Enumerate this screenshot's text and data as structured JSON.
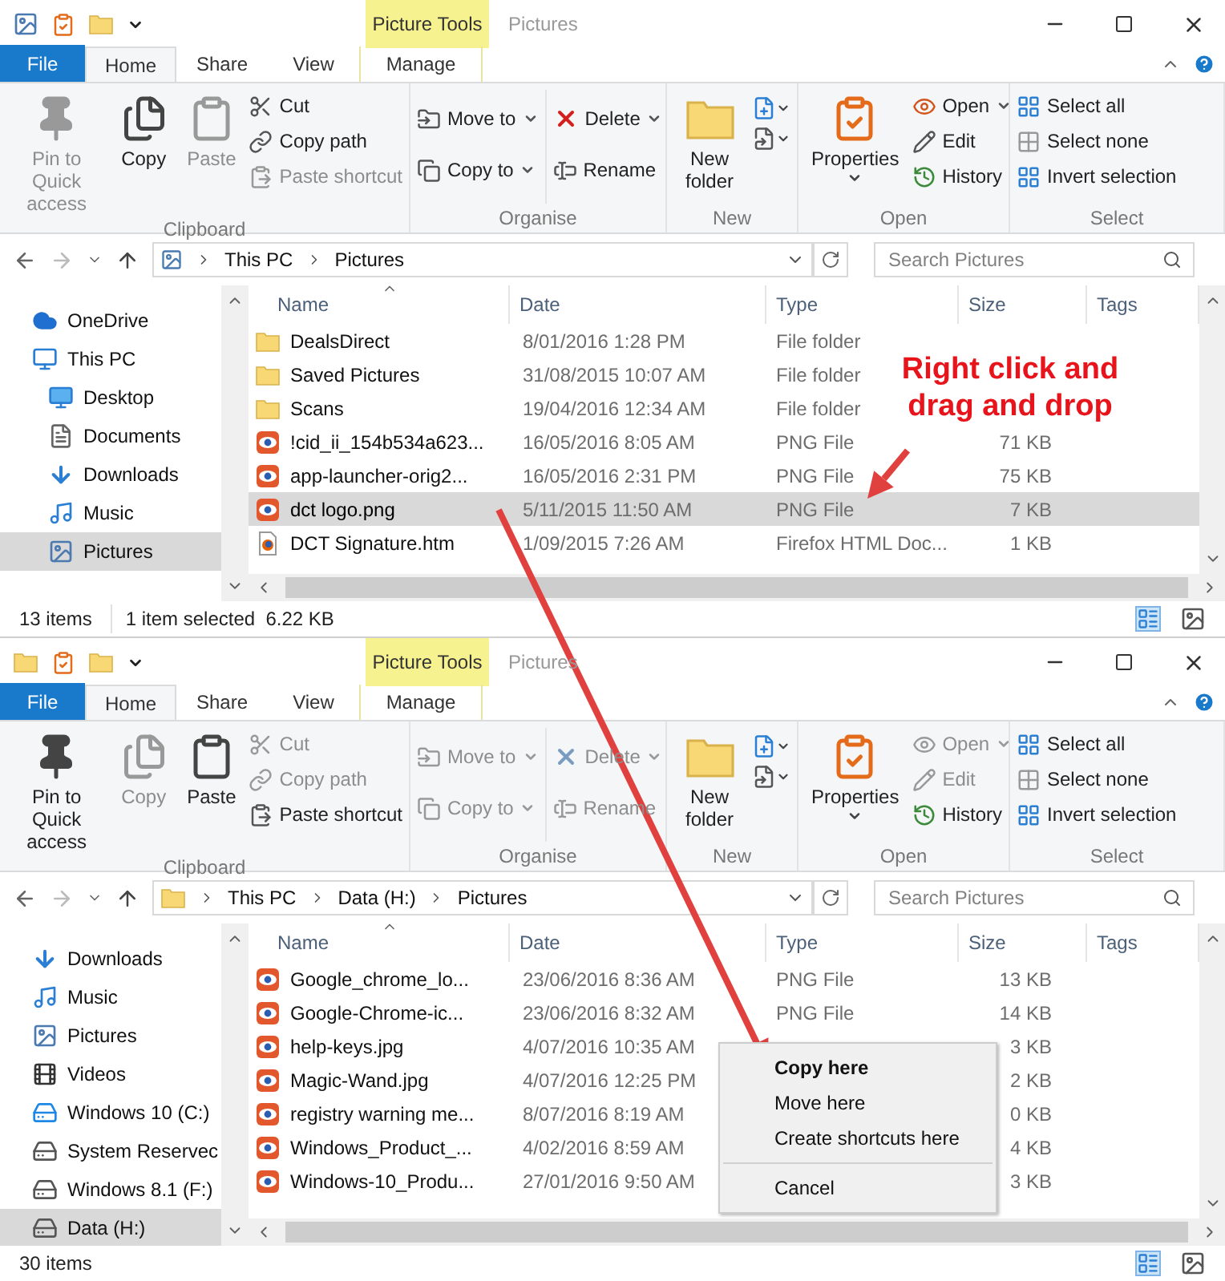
{
  "windows": [
    {
      "contextual_tab": "Picture Tools",
      "title": "Pictures",
      "file_tab": "File",
      "tabs": [
        {
          "label": "Home",
          "selected": true
        },
        {
          "label": "Share",
          "selected": false
        },
        {
          "label": "View",
          "selected": false
        },
        {
          "label": "Manage",
          "selected": false
        }
      ],
      "groups": [
        {
          "kind": "clipboard",
          "label": "Clipboard",
          "large": [
            {
              "label": "Pin to Quick access",
              "disabled": true,
              "dropdown": false
            },
            {
              "label": "Copy",
              "disabled": false,
              "dropdown": false
            },
            {
              "label": "Paste",
              "disabled": true,
              "dropdown": false
            }
          ],
          "small_columns": [
            [
              {
                "label": "Cut",
                "disabled": false,
                "dropdown": false
              },
              {
                "label": "Copy path",
                "disabled": false,
                "dropdown": false
              },
              {
                "label": "Paste shortcut",
                "disabled": true,
                "dropdown": false
              }
            ]
          ]
        },
        {
          "kind": "organise",
          "label": "Organise",
          "small_columns": [
            [
              {
                "label": "Move to",
                "disabled": false,
                "dropdown": true
              },
              {
                "label": "Copy to",
                "disabled": false,
                "dropdown": true
              }
            ],
            [
              {
                "label": "Delete",
                "disabled": false,
                "dropdown": true
              },
              {
                "label": "Rename",
                "disabled": false,
                "dropdown": false
              }
            ]
          ]
        },
        {
          "kind": "new",
          "label": "New",
          "large": [
            {
              "label": "New folder",
              "disabled": false,
              "dropdown": false
            }
          ]
        },
        {
          "kind": "open",
          "label": "Open",
          "large": [
            {
              "label": "Properties",
              "disabled": false,
              "dropdown": true
            }
          ],
          "small_columns": [
            [
              {
                "label": "Open",
                "disabled": false,
                "dropdown": true
              },
              {
                "label": "Edit",
                "disabled": false,
                "dropdown": false
              },
              {
                "label": "History",
                "disabled": false,
                "dropdown": false
              }
            ]
          ]
        },
        {
          "kind": "select",
          "label": "Select",
          "small_columns": [
            [
              {
                "label": "Select all",
                "disabled": false,
                "dropdown": false
              },
              {
                "label": "Select none",
                "disabled": false,
                "dropdown": false
              },
              {
                "label": "Invert selection",
                "disabled": false,
                "dropdown": false
              }
            ]
          ]
        }
      ],
      "path": [
        "This PC",
        "Pictures"
      ],
      "search": {
        "placeholder": "Search Pictures"
      },
      "nav": [
        {
          "label": "OneDrive",
          "kind": "cloud",
          "selected": false
        },
        {
          "label": "This PC",
          "kind": "pc",
          "selected": false,
          "children": [
            {
              "label": "Desktop",
              "kind": "desktop",
              "selected": false
            },
            {
              "label": "Documents",
              "kind": "documents",
              "selected": false
            },
            {
              "label": "Downloads",
              "kind": "downloads",
              "selected": false
            },
            {
              "label": "Music",
              "kind": "music",
              "selected": false
            },
            {
              "label": "Pictures",
              "kind": "pictures",
              "selected": true
            }
          ]
        }
      ],
      "columns": [
        "Name",
        "Date",
        "Type",
        "Size",
        "Tags"
      ],
      "rows": [
        {
          "name": "DealsDirect",
          "date": "8/01/2016 1:28 PM",
          "type": "File folder",
          "kind": "folder",
          "selected": false
        },
        {
          "name": "Saved Pictures",
          "date": "31/08/2015 10:07 AM",
          "type": "File folder",
          "kind": "folder",
          "selected": false
        },
        {
          "name": "Scans",
          "date": "19/04/2016 12:34 AM",
          "type": "File folder",
          "kind": "folder",
          "selected": false
        },
        {
          "name": "!cid_ii_154b534a623...",
          "date": "16/05/2016 8:05 AM",
          "type": "PNG File",
          "size": "71 KB",
          "kind": "image",
          "selected": false
        },
        {
          "name": "app-launcher-orig2...",
          "date": "16/05/2016 2:31 PM",
          "type": "PNG File",
          "size": "75 KB",
          "kind": "image",
          "selected": false
        },
        {
          "name": "dct logo.png",
          "date": "5/11/2015 11:50 AM",
          "type": "PNG File",
          "size": "7 KB",
          "kind": "image",
          "selected": true
        },
        {
          "name": "DCT Signature.htm",
          "date": "1/09/2015 7:26 AM",
          "type": "Firefox HTML Doc...",
          "size": "1 KB",
          "kind": "web",
          "selected": false
        }
      ],
      "status": [
        "13 items",
        "1 item selected  6.22 KB"
      ]
    },
    {
      "contextual_tab": "Picture Tools",
      "title": "Pictures",
      "file_tab": "File",
      "tabs": [
        {
          "label": "Home",
          "selected": true
        },
        {
          "label": "Share",
          "selected": false
        },
        {
          "label": "View",
          "selected": false
        },
        {
          "label": "Manage",
          "selected": false
        }
      ],
      "groups": [
        {
          "kind": "clipboard",
          "label": "Clipboard",
          "large": [
            {
              "label": "Pin to Quick access",
              "disabled": false,
              "dropdown": false
            },
            {
              "label": "Copy",
              "disabled": true,
              "dropdown": false
            },
            {
              "label": "Paste",
              "disabled": false,
              "dropdown": false
            }
          ],
          "small_columns": [
            [
              {
                "label": "Cut",
                "disabled": true,
                "dropdown": false
              },
              {
                "label": "Copy path",
                "disabled": true,
                "dropdown": false
              },
              {
                "label": "Paste shortcut",
                "disabled": false,
                "dropdown": false
              }
            ]
          ]
        },
        {
          "kind": "organise",
          "label": "Organise",
          "small_columns": [
            [
              {
                "label": "Move to",
                "disabled": true,
                "dropdown": true
              },
              {
                "label": "Copy to",
                "disabled": true,
                "dropdown": true
              }
            ],
            [
              {
                "label": "Delete",
                "disabled": true,
                "dropdown": true
              },
              {
                "label": "Rename",
                "disabled": true,
                "dropdown": false
              }
            ]
          ]
        },
        {
          "kind": "new",
          "label": "New",
          "large": [
            {
              "label": "New folder",
              "disabled": false,
              "dropdown": false
            }
          ]
        },
        {
          "kind": "open",
          "label": "Open",
          "large": [
            {
              "label": "Properties",
              "disabled": false,
              "dropdown": true
            }
          ],
          "small_columns": [
            [
              {
                "label": "Open",
                "disabled": true,
                "dropdown": true
              },
              {
                "label": "Edit",
                "disabled": true,
                "dropdown": false
              },
              {
                "label": "History",
                "disabled": false,
                "dropdown": false
              }
            ]
          ]
        },
        {
          "kind": "select",
          "label": "Select",
          "small_columns": [
            [
              {
                "label": "Select all",
                "disabled": false,
                "dropdown": false
              },
              {
                "label": "Select none",
                "disabled": false,
                "dropdown": false
              },
              {
                "label": "Invert selection",
                "disabled": false,
                "dropdown": false
              }
            ]
          ]
        }
      ],
      "path": [
        "This PC",
        "Data (H:)",
        "Pictures"
      ],
      "search": {
        "placeholder": "Search Pictures"
      },
      "nav": [
        {
          "label": "Downloads",
          "kind": "downloads",
          "selected": false
        },
        {
          "label": "Music",
          "kind": "music",
          "selected": false
        },
        {
          "label": "Pictures",
          "kind": "pictures",
          "selected": false
        },
        {
          "label": "Videos",
          "kind": "videos",
          "selected": false
        },
        {
          "label": "Windows 10 (C:)",
          "kind": "osdrive",
          "selected": false
        },
        {
          "label": "System Reservec",
          "kind": "drive",
          "selected": false
        },
        {
          "label": "Windows 8.1 (F:)",
          "kind": "drive",
          "selected": false
        },
        {
          "label": "Data (H:)",
          "kind": "drive",
          "selected": true
        }
      ],
      "columns": [
        "Name",
        "Date",
        "Type",
        "Size",
        "Tags"
      ],
      "rows": [
        {
          "name": "Google_chrome_lo...",
          "date": "23/06/2016 8:36 AM",
          "type": "PNG File",
          "size": "13 KB",
          "kind": "image",
          "selected": false
        },
        {
          "name": "Google-Chrome-ic...",
          "date": "23/06/2016 8:32 AM",
          "type": "PNG File",
          "size": "14 KB",
          "kind": "image",
          "selected": false
        },
        {
          "name": "help-keys.jpg",
          "date": "4/07/2016 10:35 AM",
          "size": "3 KB",
          "kind": "image",
          "selected": false
        },
        {
          "name": "Magic-Wand.jpg",
          "date": "4/07/2016 12:25 PM",
          "size": "2 KB",
          "kind": "image",
          "selected": false
        },
        {
          "name": "registry warning me...",
          "date": "8/07/2016 8:19 AM",
          "size": "0 KB",
          "kind": "image",
          "selected": false
        },
        {
          "name": "Windows_Product_...",
          "date": "4/02/2016 8:59 AM",
          "size": "4 KB",
          "kind": "image",
          "selected": false
        },
        {
          "name": "Windows-10_Produ...",
          "date": "27/01/2016 9:50 AM",
          "size": "3 KB",
          "kind": "image",
          "selected": false
        }
      ],
      "context_menu": [
        {
          "kind": "item",
          "label": "Copy here",
          "default": true
        },
        {
          "kind": "item",
          "label": "Move here",
          "default": false
        },
        {
          "kind": "item",
          "label": "Create shortcuts here",
          "default": false
        },
        {
          "kind": "separator"
        },
        {
          "kind": "item",
          "label": "Cancel",
          "default": false
        }
      ],
      "status": [
        "30 items"
      ]
    }
  ],
  "annotation": "Right click and drag and drop"
}
